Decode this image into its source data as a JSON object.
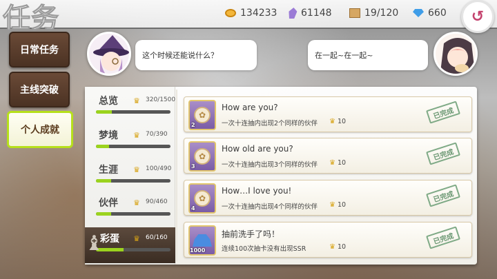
{
  "header": {
    "title": "任务",
    "resources": [
      {
        "icon": "gold-coin-icon",
        "value": "134233"
      },
      {
        "icon": "purple-crystal-icon",
        "value": "61148"
      },
      {
        "icon": "crate-icon",
        "value": "19/120"
      },
      {
        "icon": "diamond-icon",
        "value": "660"
      }
    ],
    "back_icon": "back-arrow-icon"
  },
  "sidebar": {
    "items": [
      {
        "label": "日常任务",
        "active": false
      },
      {
        "label": "主线突破",
        "active": false
      },
      {
        "label": "个人成就",
        "active": true
      }
    ]
  },
  "dialogue": {
    "left_text": "这个时候还能说什么？",
    "right_text": "在一起~在一起~"
  },
  "categories": [
    {
      "name": "总览",
      "count": "320/1500",
      "progress": 0.21,
      "active": false
    },
    {
      "name": "梦境",
      "count": "70/390",
      "progress": 0.18,
      "active": false
    },
    {
      "name": "生涯",
      "count": "100/490",
      "progress": 0.2,
      "active": false
    },
    {
      "name": "伙伴",
      "count": "90/460",
      "progress": 0.2,
      "active": false
    },
    {
      "name": "彩蛋",
      "count": "60/160",
      "progress": 0.37,
      "active": true
    }
  ],
  "achievements": [
    {
      "title": "How are you?",
      "desc": "一次十连抽内出现2个同样的伙伴",
      "reward": "10",
      "badge": "2",
      "status": "已完成"
    },
    {
      "title": "How old are you?",
      "desc": "一次十连抽内出现3个同样的伙伴",
      "reward": "10",
      "badge": "3",
      "status": "已完成"
    },
    {
      "title": "How…I love you!",
      "desc": "一次十连抽内出现4个同样的伙伴",
      "reward": "10",
      "badge": "4",
      "status": "已完成"
    },
    {
      "title": "抽前洗手了吗！",
      "desc": "连续100次抽卡没有出现SSR",
      "reward": "10",
      "badge": "1000",
      "status": "已完成"
    }
  ],
  "colors": {
    "accent": "#9bd31e",
    "stamp": "#6b9873",
    "crown": "#d7a316"
  }
}
